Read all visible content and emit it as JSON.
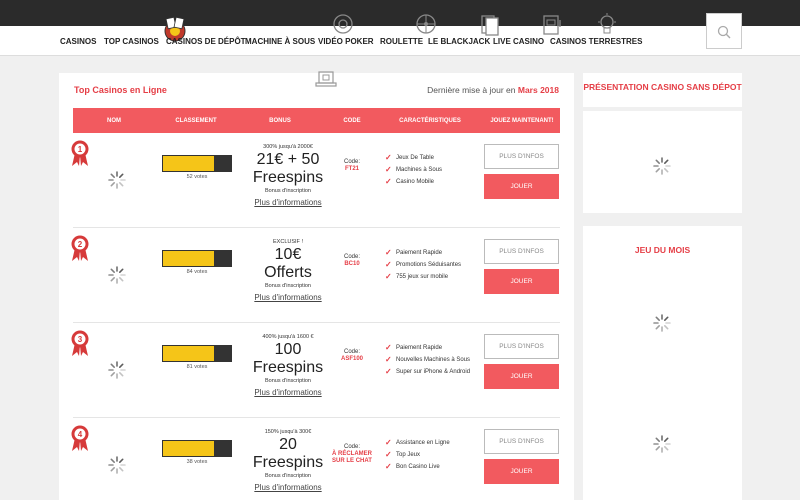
{
  "nav": {
    "items": [
      "CASINOS",
      "TOP CASINOS",
      "CASINOS DE DÉPÔT",
      "MACHINE À SOUS",
      "VIDÉO POKER",
      "ROULETTE",
      "LE BLACKJACK",
      "LIVE CASINO",
      "CASINOS TERRESTRES"
    ]
  },
  "main": {
    "title": "Top Casinos en Ligne",
    "update_prefix": "Dernière mise à jour en",
    "update_date": "Mars 2018",
    "headers": [
      "NOM",
      "CLASSEMENT",
      "BONUS",
      "CODE",
      "CARACTÉRISTIQUES",
      "JOUEZ MAINTENANT!"
    ]
  },
  "rows": [
    {
      "rank": "1",
      "rating": 0.75,
      "votes": "52 votes",
      "bonus_pre": "300% jusqu'à 2000€",
      "bonus_main": "21€ + 50",
      "bonus_main2": "Freespins",
      "bonus_sub": "Bonus d'inscription",
      "more": "Plus d'informations",
      "code_label": "Code:",
      "code_value": "FT21",
      "features": [
        "Jeux De Table",
        "Machines à Sous",
        "Casino Mobile"
      ],
      "info_label": "PLUS D'INFOS",
      "play_label": "JOUER"
    },
    {
      "rank": "2",
      "rating": 0.75,
      "votes": "84 votes",
      "bonus_pre": "EXCLUSIF !",
      "bonus_main": "10€",
      "bonus_main2": "Offerts",
      "bonus_sub": "Bonus d'inscription",
      "more": "Plus d'informations",
      "code_label": "Code:",
      "code_value": "BC10",
      "features": [
        "Paiement Rapide",
        "Promotions Séduisantes",
        "755 jeux sur mobile"
      ],
      "info_label": "PLUS D'INFOS",
      "play_label": "JOUER"
    },
    {
      "rank": "3",
      "rating": 0.75,
      "votes": "81 votes",
      "bonus_pre": "400% jusqu'à 1600 €",
      "bonus_main": "100",
      "bonus_main2": "Freespins",
      "bonus_sub": "Bonus d'inscription",
      "more": "Plus d'informations",
      "code_label": "Code:",
      "code_value": "ASF100",
      "features": [
        "Paiement Rapide",
        "Nouvelles Machines à Sous",
        "Super sur iPhone & Android"
      ],
      "info_label": "PLUS D'INFOS",
      "play_label": "JOUER"
    },
    {
      "rank": "4",
      "rating": 0.75,
      "votes": "38 votes",
      "bonus_pre": "150% jusqu'à 300€",
      "bonus_main": "20",
      "bonus_main2": "Freespins",
      "bonus_sub": "Bonus d'inscription",
      "more": "Plus d'informations",
      "code_label": "Code:",
      "code_value": "À RÉCLAMER SUR LE CHAT",
      "features": [
        "Assistance en Ligne",
        "Top Jeux",
        "Bon Casino Live"
      ],
      "info_label": "PLUS D'INFOS",
      "play_label": "JOUER"
    }
  ],
  "sidebar": {
    "presentation_title": "PRÉSENTATION CASINO SANS DÉPOT",
    "game_title": "JEU DU MOIS"
  },
  "colors": {
    "accent": "#f25a5f",
    "accent_text": "#e53e46",
    "rating": "#f5c518",
    "topbar": "#2b2b2b"
  }
}
